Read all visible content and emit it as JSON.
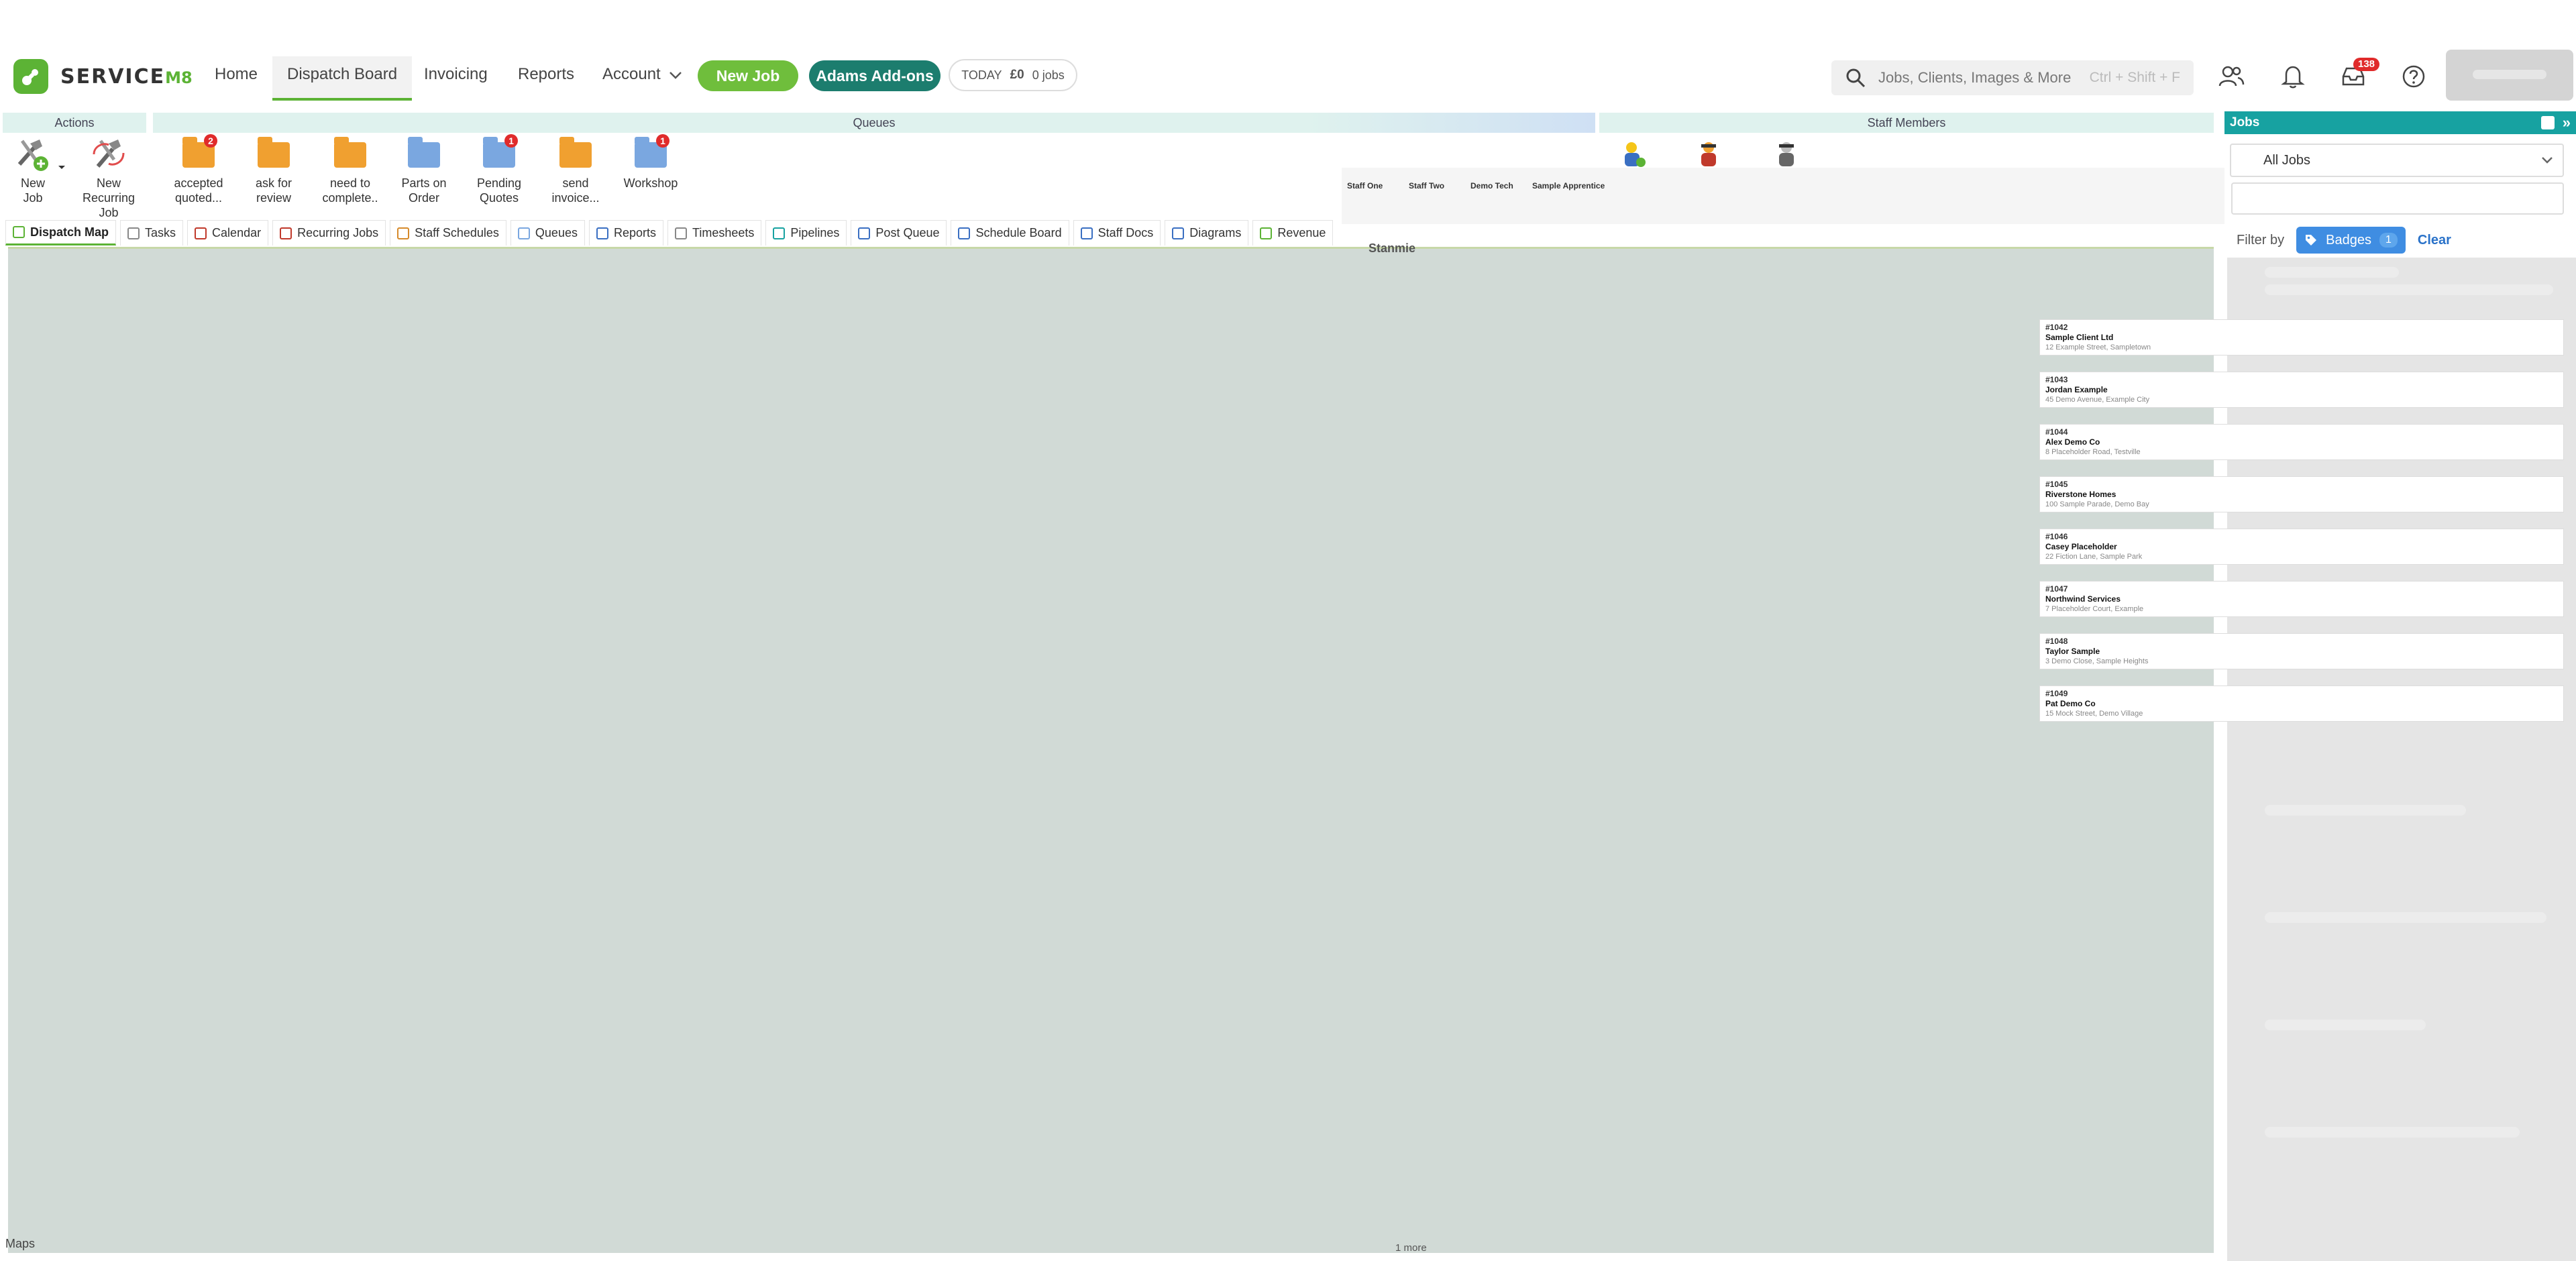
{
  "brand": {
    "name": "SERVICE",
    "suffix": "M8",
    "accent": "#5cb335"
  },
  "nav": {
    "home": "Home",
    "dispatch_board": "Dispatch Board",
    "invoicing": "Invoicing",
    "reports": "Reports",
    "account": "Account",
    "new_job": "New Job",
    "addons": "Adams Add-ons",
    "today_label": "TODAY",
    "today_amount": "£0",
    "today_jobs": "0 jobs"
  },
  "search": {
    "placeholder": "Jobs, Clients, Images & More",
    "shortcut": "Ctrl + Shift + F"
  },
  "notifications": {
    "inbox_count": "138"
  },
  "actions": {
    "title": "Actions",
    "new_job": "New Job",
    "new_recurring": "New Recurring Job"
  },
  "queues": {
    "title": "Queues",
    "items": [
      {
        "label": "accepted quoted...",
        "count": "2",
        "color": "#f0a030"
      },
      {
        "label": "ask for review",
        "count": "",
        "color": "#f0a030"
      },
      {
        "label": "need to complete..",
        "count": "",
        "color": "#f0a030"
      },
      {
        "label": "Parts on Order",
        "count": "",
        "color": "#7aa7e0"
      },
      {
        "label": "Pending Quotes",
        "count": "1",
        "color": "#7aa7e0"
      },
      {
        "label": "send invoice...",
        "count": "",
        "color": "#f0a030"
      },
      {
        "label": "Workshop",
        "count": "1",
        "color": "#7aa7e0"
      }
    ]
  },
  "staff": {
    "title": "Staff Members",
    "names": [
      "Staff One",
      "Staff Two",
      "Demo Tech",
      "Sample Apprentice"
    ]
  },
  "tabs": [
    "Dispatch Map",
    "Tasks",
    "Calendar",
    "Recurring Jobs",
    "Staff Schedules",
    "Queues",
    "Reports",
    "Timesheets",
    "Pipelines",
    "Post Queue",
    "Schedule Board",
    "Staff Docs",
    "Diagrams",
    "Revenue"
  ],
  "map": {
    "top_label": "Stanmie",
    "attribution": "Maps",
    "more": "1 more"
  },
  "jobs_panel": {
    "title": "Jobs",
    "select": "All Jobs",
    "filter_label": "Filter by",
    "badge": "Badges",
    "badge_count": "1",
    "clear": "Clear"
  },
  "jobs": [
    {
      "number": "#1042",
      "client": "Sample Client Ltd",
      "address": "12 Example Street, Sampletown"
    },
    {
      "number": "#1043",
      "client": "Jordan Example",
      "address": "45 Demo Avenue, Example City"
    },
    {
      "number": "#1044",
      "client": "Alex Demo Co",
      "address": "8 Placeholder Road, Testville"
    },
    {
      "number": "#1045",
      "client": "Riverstone Homes",
      "address": "100 Sample Parade, Demo Bay"
    },
    {
      "number": "#1046",
      "client": "Casey Placeholder",
      "address": "22 Fiction Lane, Sample Park"
    },
    {
      "number": "#1047",
      "client": "Northwind Services",
      "address": "7 Placeholder Court, Example"
    },
    {
      "number": "#1048",
      "client": "Taylor Sample",
      "address": "3 Demo Close, Sample Heights"
    },
    {
      "number": "#1049",
      "client": "Pat Demo Co",
      "address": "15 Mock Street, Demo Village"
    }
  ]
}
